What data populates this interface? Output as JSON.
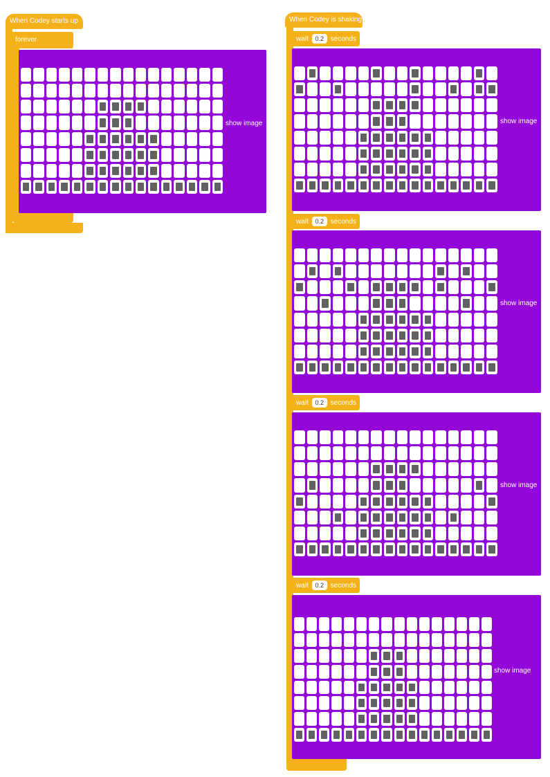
{
  "colors": {
    "control": "#f5b11a",
    "looks": "#9308d9",
    "led_on": "#616161",
    "led_off": "#ffffff"
  },
  "script1": {
    "hat_label": "When Codey starts up",
    "forever_label": "forever",
    "show_label": "show image",
    "rows": [
      "................",
      "................",
      "......####......",
      "......###.......",
      ".....######.....",
      ".....######.....",
      ".....######.....",
      "################"
    ]
  },
  "script2": {
    "hat_label": "When Codey is shaking",
    "waits": [
      {
        "label": "wait",
        "value": "0.2",
        "unit": "seconds"
      },
      {
        "label": "wait",
        "value": "0.2",
        "unit": "seconds"
      },
      {
        "label": "wait",
        "value": "0.2",
        "unit": "seconds"
      },
      {
        "label": "wait",
        "value": "0.2",
        "unit": "seconds"
      }
    ],
    "shows": [
      {
        "label": "show image",
        "rows": [
          ".#....#..#....#.",
          "#..#.....#..#.##",
          "......####......",
          "......###.......",
          ".....######.....",
          ".....######.....",
          ".....######.....",
          "################"
        ]
      },
      {
        "label": "show image",
        "rows": [
          "................",
          ".#.#.......#.#..",
          "#...#.####.#...#",
          "..#...###....#..",
          ".....######.....",
          ".....######.....",
          ".....######.....",
          "################"
        ]
      },
      {
        "label": "show image",
        "rows": [
          "................",
          "................",
          "......####......",
          ".#....###.....#.",
          "#....######....#",
          "...#.######.#...",
          ".....######.....",
          "################"
        ]
      },
      {
        "label": "show image",
        "rows": [
          "................",
          "................",
          "......###.......",
          "......###.......",
          ".....#####......",
          ".....#####......",
          ".....#####......",
          "################"
        ]
      }
    ]
  }
}
